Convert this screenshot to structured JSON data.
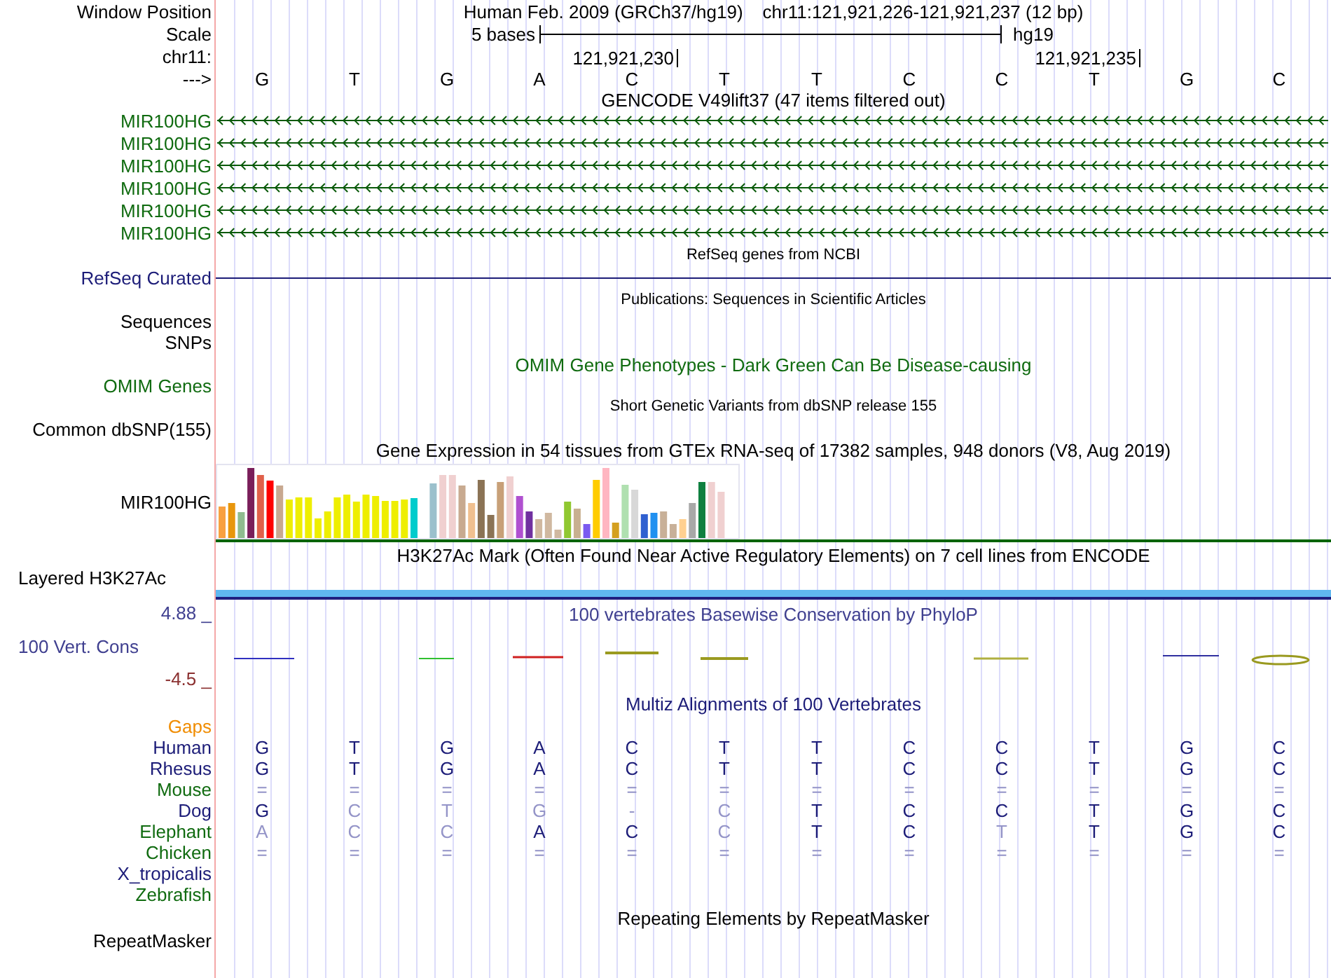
{
  "header": {
    "window_position_label": "Window Position",
    "position_text": "Human Feb. 2009 (GRCh37/hg19)",
    "range_text": "chr11:121,921,226-121,921,237 (12 bp)",
    "scale_label": "Scale",
    "scale_text": "5 bases",
    "assembly": "hg19",
    "chrom_label": "chr11:",
    "coord_ticks": [
      "121,921,230",
      "121,921,235"
    ],
    "strand_label": "--->",
    "bases": [
      "G",
      "T",
      "G",
      "A",
      "C",
      "T",
      "T",
      "C",
      "C",
      "T",
      "G",
      "C"
    ]
  },
  "gencode": {
    "title": "GENCODE V49lift37 (47 items filtered out)",
    "items": [
      {
        "label": "MIR100HG"
      },
      {
        "label": "MIR100HG"
      },
      {
        "label": "MIR100HG"
      },
      {
        "label": "MIR100HG"
      },
      {
        "label": "MIR100HG"
      },
      {
        "label": "MIR100HG"
      }
    ]
  },
  "refseq": {
    "title": "RefSeq genes from NCBI",
    "label": "RefSeq Curated"
  },
  "publications": {
    "title": "Publications: Sequences in Scientific Articles",
    "labels": [
      "Sequences",
      "SNPs"
    ]
  },
  "omim": {
    "title": "OMIM Gene Phenotypes - Dark Green Can Be Disease-causing",
    "label": "OMIM Genes"
  },
  "dbsnp": {
    "title": "Short Genetic Variants from dbSNP release 155",
    "label": "Common dbSNP(155)"
  },
  "gtex": {
    "title": "Gene Expression in 54 tissues from GTEx RNA-seq of 17382 samples, 948 donors (V8, Aug 2019)",
    "label": "MIR100HG"
  },
  "h3k27ac": {
    "title": "H3K27Ac Mark (Often Found Near Active Regulatory Elements) on 7 cell lines from ENCODE",
    "label": "Layered H3K27Ac"
  },
  "phylop": {
    "title": "100 vertebrates Basewise Conservation by PhyloP",
    "label": "100 Vert. Cons",
    "max_label": "4.88 _",
    "min_label": "-4.5 _"
  },
  "multiz": {
    "title": "Multiz Alignments of 100 Vertebrates",
    "gaps_label": "Gaps",
    "species": [
      {
        "name": "Human",
        "color": "#1c1c78",
        "bases": [
          {
            "base": "G",
            "faded": false
          },
          {
            "base": "T",
            "faded": false
          },
          {
            "base": "G",
            "faded": false
          },
          {
            "base": "A",
            "faded": false
          },
          {
            "base": "C",
            "faded": false
          },
          {
            "base": "T",
            "faded": false
          },
          {
            "base": "T",
            "faded": false
          },
          {
            "base": "C",
            "faded": false
          },
          {
            "base": "C",
            "faded": false
          },
          {
            "base": "T",
            "faded": false
          },
          {
            "base": "G",
            "faded": false
          },
          {
            "base": "C",
            "faded": false
          }
        ]
      },
      {
        "name": "Rhesus",
        "color": "#1c1c78",
        "bases": [
          {
            "base": "G",
            "faded": false
          },
          {
            "base": "T",
            "faded": false
          },
          {
            "base": "G",
            "faded": false
          },
          {
            "base": "A",
            "faded": false
          },
          {
            "base": "C",
            "faded": false
          },
          {
            "base": "T",
            "faded": false
          },
          {
            "base": "T",
            "faded": false
          },
          {
            "base": "C",
            "faded": false
          },
          {
            "base": "C",
            "faded": false
          },
          {
            "base": "T",
            "faded": false
          },
          {
            "base": "G",
            "faded": false
          },
          {
            "base": "C",
            "faded": false
          }
        ]
      },
      {
        "name": "Mouse",
        "color": "#106b10",
        "bases": [
          {
            "base": "=",
            "faded": true
          },
          {
            "base": "=",
            "faded": true
          },
          {
            "base": "=",
            "faded": true
          },
          {
            "base": "=",
            "faded": true
          },
          {
            "base": "=",
            "faded": true
          },
          {
            "base": "=",
            "faded": true
          },
          {
            "base": "=",
            "faded": true
          },
          {
            "base": "=",
            "faded": true
          },
          {
            "base": "=",
            "faded": true
          },
          {
            "base": "=",
            "faded": true
          },
          {
            "base": "=",
            "faded": true
          },
          {
            "base": "=",
            "faded": true
          }
        ]
      },
      {
        "name": "Dog",
        "color": "#1c1c78",
        "bases": [
          {
            "base": "G",
            "faded": false
          },
          {
            "base": "C",
            "faded": true
          },
          {
            "base": "T",
            "faded": true
          },
          {
            "base": "G",
            "faded": true
          },
          {
            "base": "-",
            "faded": true
          },
          {
            "base": "C",
            "faded": true
          },
          {
            "base": "T",
            "faded": false
          },
          {
            "base": "C",
            "faded": false
          },
          {
            "base": "C",
            "faded": false
          },
          {
            "base": "T",
            "faded": false
          },
          {
            "base": "G",
            "faded": false
          },
          {
            "base": "C",
            "faded": false
          }
        ]
      },
      {
        "name": "Elephant",
        "color": "#106b10",
        "bases": [
          {
            "base": "A",
            "faded": true
          },
          {
            "base": "C",
            "faded": true
          },
          {
            "base": "C",
            "faded": true
          },
          {
            "base": "A",
            "faded": false
          },
          {
            "base": "C",
            "faded": false
          },
          {
            "base": "C",
            "faded": true
          },
          {
            "base": "T",
            "faded": false
          },
          {
            "base": "C",
            "faded": false
          },
          {
            "base": "T",
            "faded": true
          },
          {
            "base": "T",
            "faded": false
          },
          {
            "base": "G",
            "faded": false
          },
          {
            "base": "C",
            "faded": false
          }
        ]
      },
      {
        "name": "Chicken",
        "color": "#106b10",
        "bases": [
          {
            "base": "=",
            "faded": true
          },
          {
            "base": "=",
            "faded": true
          },
          {
            "base": "=",
            "faded": true
          },
          {
            "base": "=",
            "faded": true
          },
          {
            "base": "=",
            "faded": true
          },
          {
            "base": "=",
            "faded": true
          },
          {
            "base": "=",
            "faded": true
          },
          {
            "base": "=",
            "faded": true
          },
          {
            "base": "=",
            "faded": true
          },
          {
            "base": "=",
            "faded": true
          },
          {
            "base": "=",
            "faded": true
          },
          {
            "base": "=",
            "faded": true
          }
        ]
      },
      {
        "name": "X_tropicalis",
        "color": "#1c1c78"
      },
      {
        "name": "Zebrafish",
        "color": "#106b10"
      }
    ]
  },
  "repeatmasker": {
    "title": "Repeating Elements by RepeatMasker",
    "label": "RepeatMasker"
  }
}
